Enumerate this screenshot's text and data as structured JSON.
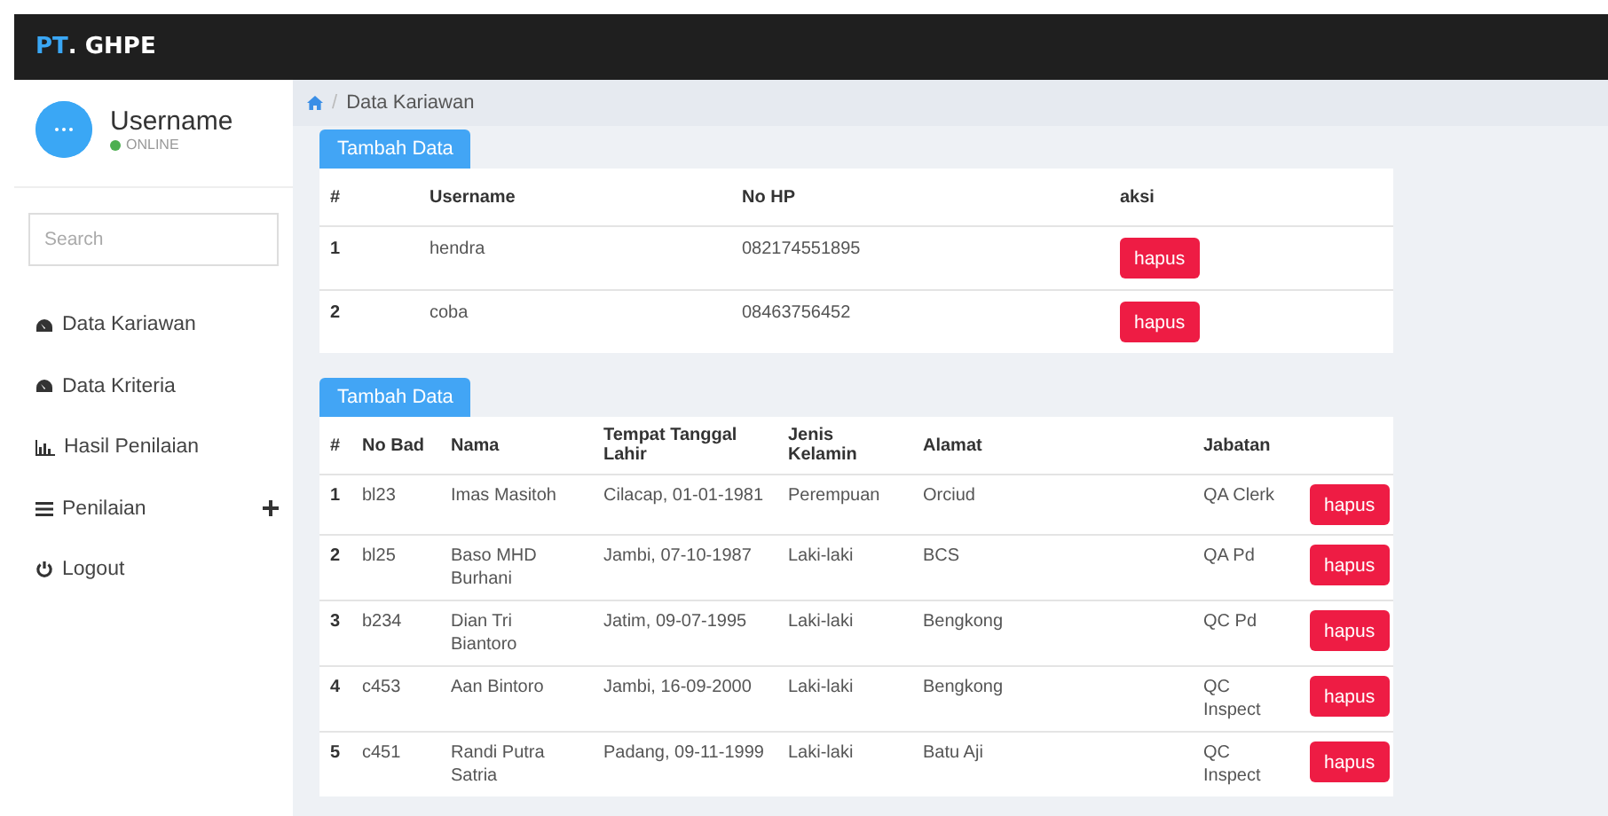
{
  "header": {
    "brand_prefix": "PT",
    "brand_rest": ". GHPE"
  },
  "sidebar": {
    "user": {
      "name": "Username",
      "status": "ONLINE",
      "online": true
    },
    "search": {
      "placeholder": "Search"
    },
    "items": [
      {
        "kind": "dashboard",
        "label": "Data Kariawan",
        "has_submenu": false
      },
      {
        "kind": "dashboard",
        "label": "Data Kriteria",
        "has_submenu": false
      },
      {
        "kind": "chart",
        "label": "Hasil Penilaian",
        "has_submenu": false
      },
      {
        "kind": "list",
        "label": "Penilaian",
        "has_submenu": true
      },
      {
        "kind": "power",
        "label": "Logout",
        "has_submenu": false
      }
    ]
  },
  "breadcrumb": {
    "separator": "/",
    "current": "Data Kariawan"
  },
  "tables": [
    {
      "add_button": "Tambah Data",
      "columns": [
        "#",
        "Username",
        "No HP",
        "aksi"
      ],
      "rows": [
        {
          "cells": [
            "1",
            "hendra",
            "082174551895"
          ],
          "action": "hapus"
        },
        {
          "cells": [
            "2",
            "coba",
            "08463756452"
          ],
          "action": "hapus"
        }
      ]
    },
    {
      "add_button": "Tambah Data",
      "columns": [
        "#",
        "No Bad",
        "Nama",
        "Tempat Tanggal Lahir",
        "Jenis Kelamin",
        "Alamat",
        "Jabatan"
      ],
      "rows": [
        {
          "cells": [
            "1",
            "bl23",
            "Imas Masitoh",
            "Cilacap, 01-01-1981",
            "Perempuan",
            "Orciud",
            "QA Clerk"
          ],
          "action": "hapus"
        },
        {
          "cells": [
            "2",
            "bl25",
            "Baso MHD Burhani",
            "Jambi, 07-10-1987",
            "Laki-laki",
            "BCS",
            "QA Pd"
          ],
          "action": "hapus"
        },
        {
          "cells": [
            "3",
            "b234",
            "Dian Tri Biantoro",
            "Jatim, 09-07-1995",
            "Laki-laki",
            "Bengkong",
            "QC Pd"
          ],
          "action": "hapus"
        },
        {
          "cells": [
            "4",
            "c453",
            "Aan Bintoro",
            "Jambi, 16-09-2000",
            "Laki-laki",
            "Bengkong",
            "QC Inspect"
          ],
          "action": "hapus"
        },
        {
          "cells": [
            "5",
            "c451",
            "Randi Putra Satria",
            "Padang, 09-11-1999",
            "Laki-laki",
            "Batu Aji",
            "QC Inspect"
          ],
          "action": "hapus"
        }
      ]
    }
  ]
}
